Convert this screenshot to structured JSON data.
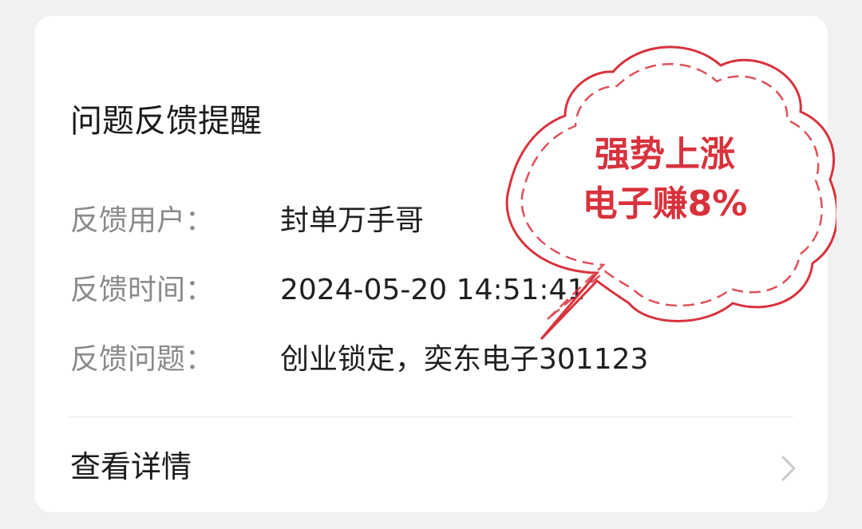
{
  "card": {
    "title": "问题反馈提醒",
    "rows": [
      {
        "label": "反馈用户：",
        "value": "封单万手哥"
      },
      {
        "label": "反馈时间：",
        "value": "2024-05-20 14:51:41"
      },
      {
        "label": "反馈问题：",
        "value": "创业锁定，奕东电子301123"
      }
    ],
    "details_label": "查看详情",
    "details_icon": "chevron-right-icon"
  },
  "sticker": {
    "line1": "强势上涨",
    "line2": "电子赚8%",
    "color": "#d8323c",
    "fill": "#ffffff"
  },
  "colors": {
    "background": "#f1f1f1",
    "card": "#ffffff",
    "label": "#8a8a8a",
    "value": "#1f1f1f",
    "accent_red": "#d8323c"
  }
}
